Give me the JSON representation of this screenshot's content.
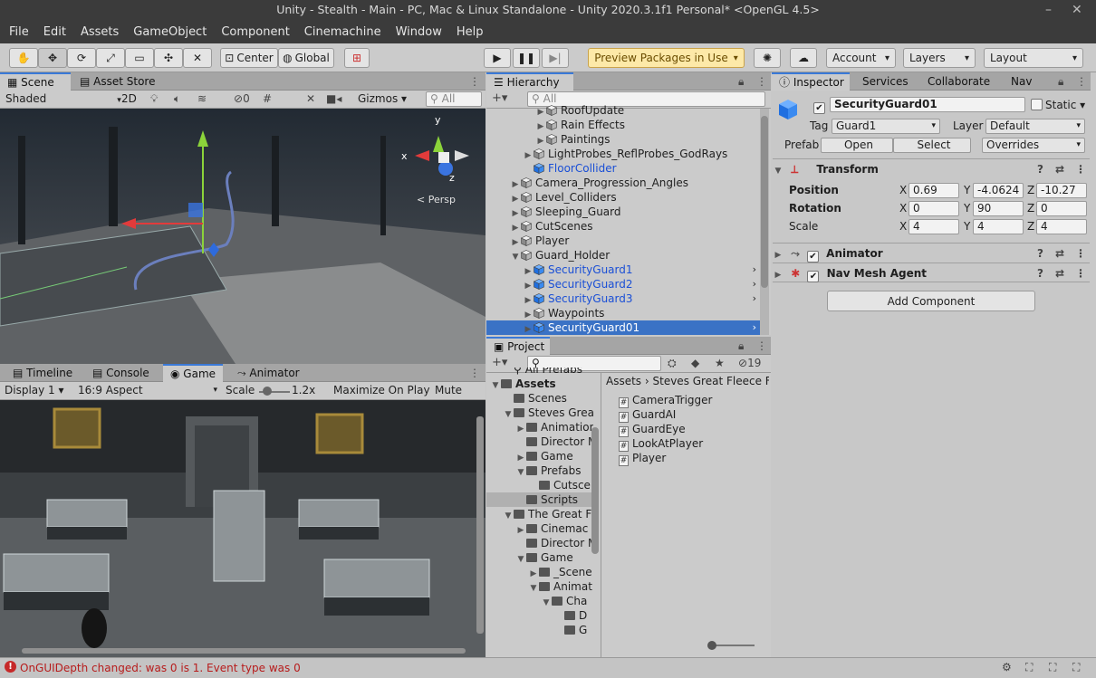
{
  "window": {
    "title": "Unity - Stealth - Main - PC, Mac & Linux Standalone - Unity 2020.3.1f1 Personal* <OpenGL 4.5>"
  },
  "menu": [
    "File",
    "Edit",
    "Assets",
    "GameObject",
    "Component",
    "Cinemachine",
    "Window",
    "Help"
  ],
  "toolbar": {
    "pivot": "Center",
    "space": "Global",
    "preview_packages": "Preview Packages in Use",
    "account": "Account",
    "layers": "Layers",
    "layout": "Layout"
  },
  "scene_panel": {
    "tabs": [
      "Scene",
      "Asset Store"
    ],
    "shading": "Shaded",
    "mode_2d": "2D",
    "hidden_count": "0",
    "gizmos": "Gizmos",
    "search_placeholder": "All",
    "persp": "< Persp",
    "axis_y": "y",
    "axis_x": "x",
    "axis_z": "z"
  },
  "game_panel": {
    "tabs": [
      "Timeline",
      "Console",
      "Game",
      "Animator"
    ],
    "display": "Display 1",
    "aspect": "16:9 Aspect",
    "scale_label": "Scale",
    "scale_value": "1.2x",
    "maximize": "Maximize On Play",
    "mute": "Mute Aud"
  },
  "hierarchy": {
    "tab": "Hierarchy",
    "search_placeholder": "All",
    "items": [
      {
        "label": "RoofUpdate",
        "indent": 3,
        "arrow": "▶",
        "blue": false
      },
      {
        "label": "Rain Effects",
        "indent": 3,
        "arrow": "▶",
        "blue": false
      },
      {
        "label": "Paintings",
        "indent": 3,
        "arrow": "▶",
        "blue": false
      },
      {
        "label": "LightProbes_ReflProbes_GodRays",
        "indent": 2,
        "arrow": "▶",
        "blue": false
      },
      {
        "label": "FloorCollider",
        "indent": 2,
        "arrow": "",
        "blue": true
      },
      {
        "label": "Camera_Progression_Angles",
        "indent": 1,
        "arrow": "▶",
        "blue": false
      },
      {
        "label": "Level_Colliders",
        "indent": 1,
        "arrow": "▶",
        "blue": false
      },
      {
        "label": "Sleeping_Guard",
        "indent": 1,
        "arrow": "▶",
        "blue": false
      },
      {
        "label": "CutScenes",
        "indent": 1,
        "arrow": "▶",
        "blue": false
      },
      {
        "label": "Player",
        "indent": 1,
        "arrow": "▶",
        "blue": false
      },
      {
        "label": "Guard_Holder",
        "indent": 1,
        "arrow": "▼",
        "blue": false
      },
      {
        "label": "SecurityGuard1",
        "indent": 2,
        "arrow": "▶",
        "blue": true
      },
      {
        "label": "SecurityGuard2",
        "indent": 2,
        "arrow": "▶",
        "blue": true
      },
      {
        "label": "SecurityGuard3",
        "indent": 2,
        "arrow": "▶",
        "blue": true
      },
      {
        "label": "Waypoints",
        "indent": 2,
        "arrow": "▶",
        "blue": false
      },
      {
        "label": "SecurityGuard01",
        "indent": 2,
        "arrow": "▶",
        "blue": true,
        "selected": true
      }
    ]
  },
  "project": {
    "tab": "Project",
    "hidden_count": "19",
    "breadcrumb": [
      "Assets",
      "Steves Great Fleece Fi"
    ],
    "tree": [
      {
        "label": "All Prefabs",
        "indent": 1,
        "arrow": "",
        "type": "search"
      },
      {
        "label": "Assets",
        "indent": 0,
        "arrow": "▼",
        "type": "folder",
        "bold": true
      },
      {
        "label": "Scenes",
        "indent": 1,
        "arrow": "",
        "type": "folder"
      },
      {
        "label": "Steves Grea",
        "indent": 1,
        "arrow": "▼",
        "type": "folder"
      },
      {
        "label": "Animation",
        "indent": 2,
        "arrow": "▶",
        "type": "folder"
      },
      {
        "label": "Director M",
        "indent": 2,
        "arrow": "",
        "type": "folder"
      },
      {
        "label": "Game",
        "indent": 2,
        "arrow": "▶",
        "type": "folder"
      },
      {
        "label": "Prefabs",
        "indent": 2,
        "arrow": "▼",
        "type": "folder"
      },
      {
        "label": "Cutsce",
        "indent": 3,
        "arrow": "",
        "type": "folder"
      },
      {
        "label": "Scripts",
        "indent": 2,
        "arrow": "",
        "type": "folder",
        "selected": true
      },
      {
        "label": "The Great F",
        "indent": 1,
        "arrow": "▼",
        "type": "folder"
      },
      {
        "label": "Cinemac",
        "indent": 2,
        "arrow": "▶",
        "type": "folder"
      },
      {
        "label": "Director M",
        "indent": 2,
        "arrow": "",
        "type": "folder"
      },
      {
        "label": "Game",
        "indent": 2,
        "arrow": "▼",
        "type": "folder"
      },
      {
        "label": "_Scene",
        "indent": 3,
        "arrow": "▶",
        "type": "folder"
      },
      {
        "label": "Animat",
        "indent": 3,
        "arrow": "▼",
        "type": "folder"
      },
      {
        "label": "Cha",
        "indent": 4,
        "arrow": "▼",
        "type": "folder"
      },
      {
        "label": "D",
        "indent": 5,
        "arrow": "",
        "type": "folder"
      },
      {
        "label": "G",
        "indent": 5,
        "arrow": "",
        "type": "folder"
      }
    ],
    "scripts": [
      "CameraTrigger",
      "GuardAI",
      "GuardEye",
      "LookAtPlayer",
      "Player"
    ]
  },
  "inspector": {
    "tabs": [
      "Inspector",
      "Services",
      "Collaborate",
      "Nav"
    ],
    "object_name": "SecurityGuard01",
    "static_label": "Static",
    "tag_label": "Tag",
    "tag_value": "Guard1",
    "layer_label": "Layer",
    "layer_value": "Default",
    "prefab_label": "Prefab",
    "prefab_open": "Open",
    "prefab_select": "Select",
    "prefab_overrides": "Overrides",
    "transform": {
      "title": "Transform",
      "position_label": "Position",
      "rotation_label": "Rotation",
      "scale_label": "Scale",
      "position": {
        "x": "0.69",
        "y": "-4.0624",
        "z": "-10.27"
      },
      "rotation": {
        "x": "0",
        "y": "90",
        "z": "0"
      },
      "scale": {
        "x": "4",
        "y": "4",
        "z": "4"
      },
      "x": "X",
      "y": "Y",
      "z": "Z"
    },
    "animator_title": "Animator",
    "navmesh_title": "Nav Mesh Agent",
    "add_component": "Add Component"
  },
  "status": {
    "message": "OnGUIDepth changed: was 0 is 1. Event type was 0"
  },
  "colors": {
    "accent": "#3a79d7",
    "selection": "#3a72c5",
    "prefab_blue": "#1a4fd6",
    "preview_yellow": "#fde9a8"
  }
}
